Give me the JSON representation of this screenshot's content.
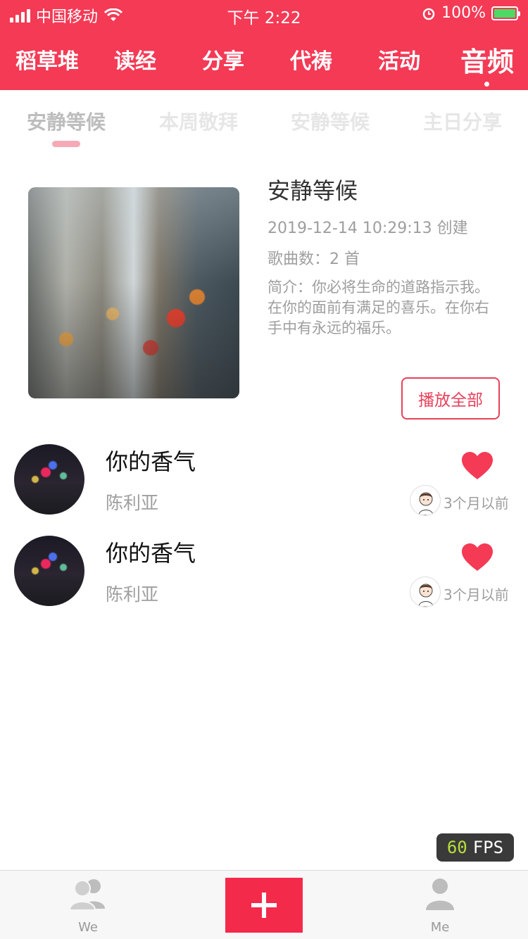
{
  "status_bar": {
    "carrier": "中国移动",
    "time": "下午 2:22",
    "battery": "100%"
  },
  "top_nav": {
    "items": [
      "稻草堆",
      "读经",
      "分享",
      "代祷",
      "活动",
      "音频"
    ],
    "active_index": 5
  },
  "sub_tabs": {
    "items": [
      "安静等候",
      "本周敬拜",
      "安静等候",
      "主日分享"
    ],
    "active_index": 0
  },
  "album": {
    "title": "安静等候",
    "created": "2019-12-14 10:29:13 创建",
    "song_count": "歌曲数：2 首",
    "description": "简介：你必将生命的道路指示我。在你的面前有满足的喜乐。在你右手中有永远的福乐。",
    "play_all_label": "播放全部"
  },
  "songs": [
    {
      "title": "你的香气",
      "artist": "陈利亚",
      "time": "3个月以前",
      "liked": true
    },
    {
      "title": "你的香气",
      "artist": "陈利亚",
      "time": "3个月以前",
      "liked": true
    }
  ],
  "fps": {
    "value": "60",
    "label": "FPS"
  },
  "tab_bar": {
    "left_label": "We",
    "right_label": "Me"
  },
  "colors": {
    "brand": "#f43a55",
    "accent": "#e8415b",
    "add_button": "#f42a4b",
    "heart": "#f43a55"
  }
}
